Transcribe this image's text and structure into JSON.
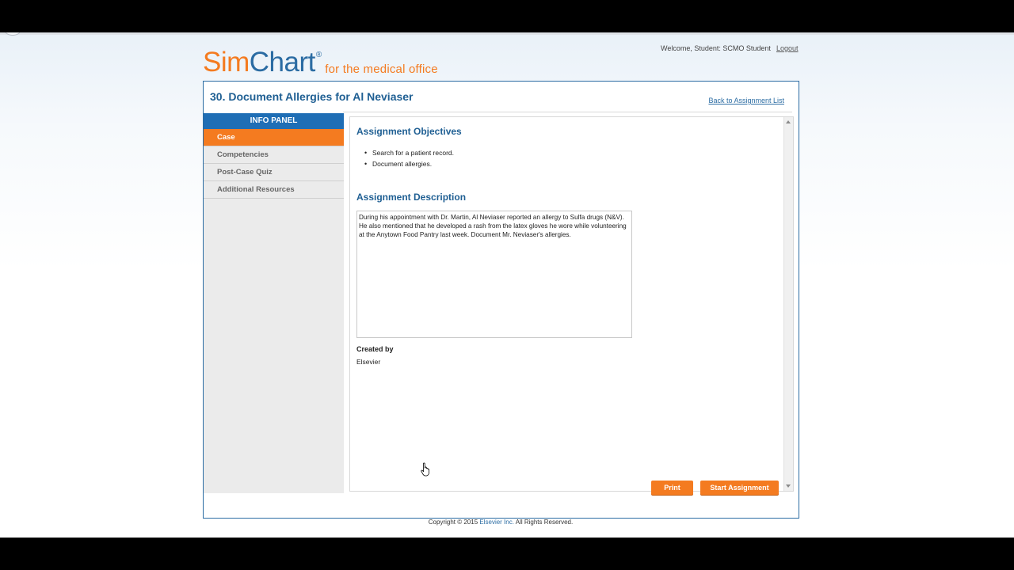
{
  "app": {
    "logo_sim": "Sim",
    "logo_chart": "Chart",
    "logo_reg": "®",
    "logo_tagline": "for the medical office"
  },
  "header": {
    "welcome_text": "Welcome, Student: SCMO Student",
    "logout_label": "Logout"
  },
  "assignment": {
    "title": "30. Document Allergies for Al Neviaser",
    "back_link": "Back to Assignment List"
  },
  "info_panel": {
    "header": "INFO PANEL",
    "items": [
      {
        "label": "Case",
        "active": true
      },
      {
        "label": "Competencies",
        "active": false
      },
      {
        "label": "Post-Case Quiz",
        "active": false
      },
      {
        "label": "Additional Resources",
        "active": false
      }
    ]
  },
  "content": {
    "objectives_heading": "Assignment Objectives",
    "objectives": [
      "Search for a patient record.",
      "Document allergies."
    ],
    "description_heading": "Assignment Description",
    "description": "During his appointment with Dr. Martin, Al Neviaser reported an allergy to Sulfa drugs (N&V). He also mentioned that he developed a rash from the latex gloves he wore while volunteering at the Anytown Food Pantry last week. Document Mr. Neviaser's allergies.",
    "created_by_label": "Created by",
    "created_by_value": "Elsevier"
  },
  "buttons": {
    "print": "Print",
    "start_assignment": "Start Assignment"
  },
  "footer": {
    "prefix": "Copyright © 2015 ",
    "company": "Elsevier Inc.",
    "suffix": " All Rights Reserved."
  },
  "colors": {
    "brand_orange": "#f47b20",
    "brand_blue": "#2b6ca3",
    "panel_header_blue": "#1f6eb5"
  }
}
